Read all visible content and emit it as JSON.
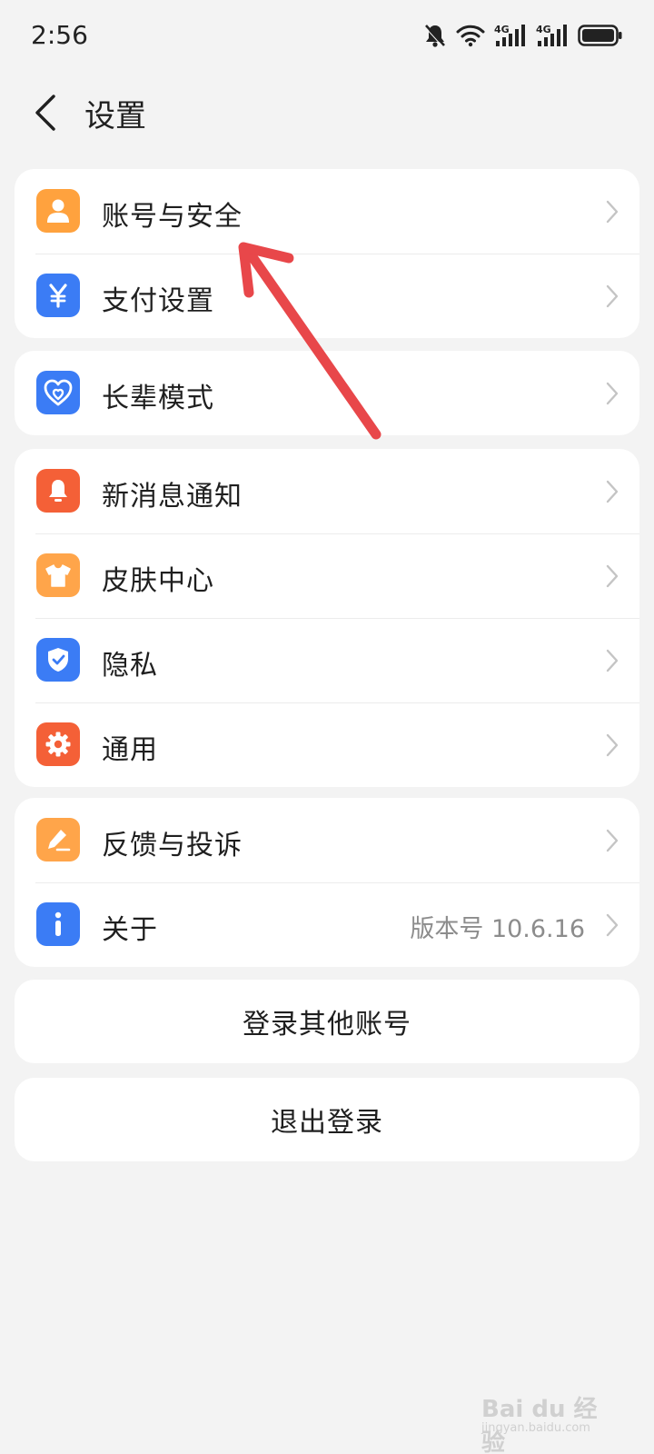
{
  "status": {
    "time": "2:56",
    "network_1": "4G",
    "network_2": "4G"
  },
  "header": {
    "title": "设置"
  },
  "sections": [
    {
      "items": [
        {
          "label": "账号与安全",
          "icon": "user-icon",
          "color": "#FF9C3A"
        },
        {
          "label": "支付设置",
          "icon": "yuan-icon",
          "color": "#3B7CF5"
        }
      ]
    },
    {
      "items": [
        {
          "label": "长辈模式",
          "icon": "heart-icon",
          "color": "#3B7CF5"
        }
      ]
    },
    {
      "items": [
        {
          "label": "新消息通知",
          "icon": "bell-icon",
          "color": "#F46037"
        },
        {
          "label": "皮肤中心",
          "icon": "shirt-icon",
          "color": "#FFA54A"
        },
        {
          "label": "隐私",
          "icon": "shield-icon",
          "color": "#3B7CF5"
        },
        {
          "label": "通用",
          "icon": "gear-icon",
          "color": "#F46037"
        }
      ]
    },
    {
      "items": [
        {
          "label": "反馈与投诉",
          "icon": "pen-icon",
          "color": "#FFA54A"
        },
        {
          "label": "关于",
          "icon": "info-icon",
          "color": "#3B7CF5",
          "value": "版本号 10.6.16"
        }
      ]
    }
  ],
  "buttons": {
    "switch_account": "登录其他账号",
    "logout": "退出登录"
  },
  "watermark": {
    "text": "Bai du 经验",
    "sub": "jingyan.baidu.com"
  },
  "colors": {
    "background": "#F3F3F3",
    "annotation_arrow": "#E8474A"
  }
}
